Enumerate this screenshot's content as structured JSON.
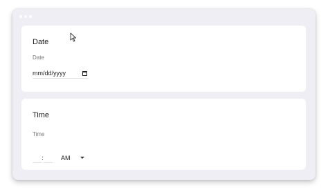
{
  "date_section": {
    "title": "Date",
    "label": "Date",
    "placeholder": "mm/dd/yyyy"
  },
  "time_section": {
    "title": "Time",
    "label": "Time",
    "separator": ":",
    "period": "AM"
  },
  "icons": {
    "calendar": "calendar-icon",
    "dropdown": "chevron-down-icon",
    "cursor": "mouse-cursor-icon"
  },
  "colors": {
    "window_background": "#f0eef5",
    "card_background": "#ffffff"
  }
}
